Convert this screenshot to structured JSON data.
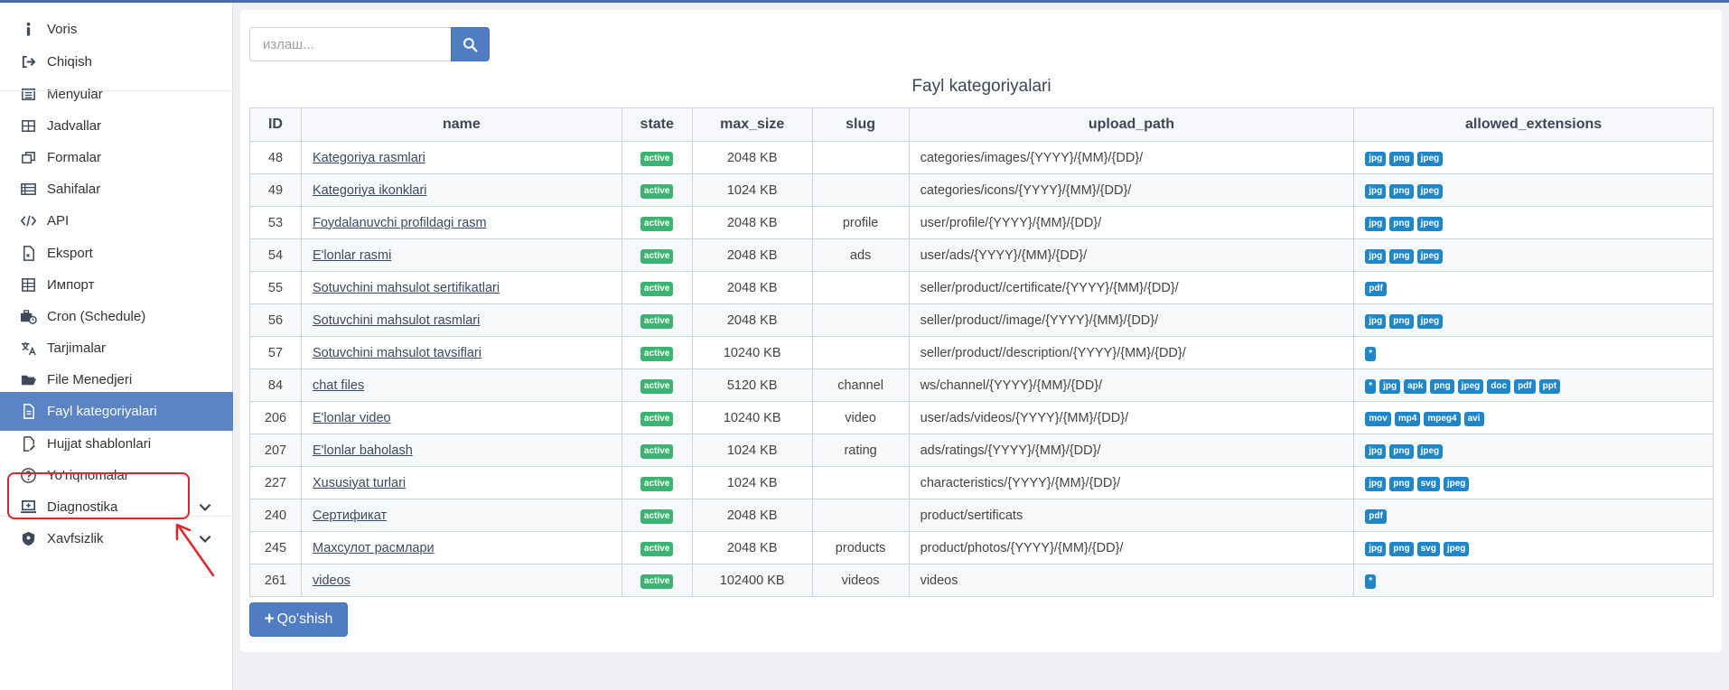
{
  "sidebar": {
    "items": [
      {
        "label": "Voris",
        "icon": "info-icon"
      },
      {
        "label": "Chiqish",
        "icon": "sign-out-icon"
      },
      {
        "label": "Menyular",
        "icon": "list-icon"
      },
      {
        "label": "Jadvallar",
        "icon": "table-icon"
      },
      {
        "label": "Formalar",
        "icon": "window-restore-icon"
      },
      {
        "label": "Sahifalar",
        "icon": "rows-icon"
      },
      {
        "label": "API",
        "icon": "code-icon"
      },
      {
        "label": "Eksport",
        "icon": "file-export-icon"
      },
      {
        "label": "Импорт",
        "icon": "file-excel-icon"
      },
      {
        "label": "Cron (Schedule)",
        "icon": "business-time-icon"
      },
      {
        "label": "Tarjimalar",
        "icon": "language-icon"
      },
      {
        "label": "File Menedjeri",
        "icon": "folder-open-icon"
      },
      {
        "label": "Fayl kategoriyalari",
        "icon": "file-icon",
        "active": true
      },
      {
        "label": "Hujjat shablonlari",
        "icon": "file-signature-icon"
      },
      {
        "label": "Yo'riqnomalar",
        "icon": "question-circle-icon"
      },
      {
        "label": "Diagnostika",
        "icon": "laptop-medical-icon",
        "expandable": true
      },
      {
        "label": "Xavfsizlik",
        "icon": "shield-icon",
        "expandable": true
      }
    ]
  },
  "search": {
    "placeholder": "излаш..."
  },
  "page": {
    "title": "Fayl kategoriyalari"
  },
  "table": {
    "columns": [
      "ID",
      "name",
      "state",
      "max_size",
      "slug",
      "upload_path",
      "allowed_extensions"
    ],
    "rows": [
      {
        "id": "48",
        "name": "Kategoriya rasmlari",
        "state": "active",
        "max_size": "2048 KB",
        "slug": "",
        "upload_path": "categories/images/{YYYY}/{MM}/{DD}/",
        "ext": [
          "jpg",
          "png",
          "jpeg"
        ]
      },
      {
        "id": "49",
        "name": "Kategoriya ikonklari",
        "state": "active",
        "max_size": "1024 KB",
        "slug": "",
        "upload_path": "categories/icons/{YYYY}/{MM}/{DD}/",
        "ext": [
          "jpg",
          "png",
          "jpeg"
        ]
      },
      {
        "id": "53",
        "name": "Foydalanuvchi profildagi rasm",
        "state": "active",
        "max_size": "2048 KB",
        "slug": "profile",
        "upload_path": "user/profile/{YYYY}/{MM}/{DD}/",
        "ext": [
          "jpg",
          "png",
          "jpeg"
        ]
      },
      {
        "id": "54",
        "name": "E'lonlar rasmi",
        "state": "active",
        "max_size": "2048 KB",
        "slug": "ads",
        "upload_path": "user/ads/{YYYY}/{MM}/{DD}/",
        "ext": [
          "jpg",
          "png",
          "jpeg"
        ]
      },
      {
        "id": "55",
        "name": "Sotuvchini mahsulot sertifikatlari",
        "state": "active",
        "max_size": "2048 KB",
        "slug": "",
        "upload_path": "seller/product//certificate/{YYYY}/{MM}/{DD}/",
        "ext": [
          "pdf"
        ]
      },
      {
        "id": "56",
        "name": "Sotuvchini mahsulot rasmlari",
        "state": "active",
        "max_size": "2048 KB",
        "slug": "",
        "upload_path": "seller/product//image/{YYYY}/{MM}/{DD}/",
        "ext": [
          "jpg",
          "png",
          "jpeg"
        ]
      },
      {
        "id": "57",
        "name": "Sotuvchini mahsulot tavsiflari",
        "state": "active",
        "max_size": "10240 KB",
        "slug": "",
        "upload_path": "seller/product//description/{YYYY}/{MM}/{DD}/",
        "ext": [
          "*"
        ]
      },
      {
        "id": "84",
        "name": "chat files",
        "state": "active",
        "max_size": "5120 KB",
        "slug": "channel",
        "upload_path": "ws/channel/{YYYY}/{MM}/{DD}/",
        "ext": [
          "*",
          "jpg",
          "apk",
          "png",
          "jpeg",
          "doc",
          "pdf",
          "ppt"
        ]
      },
      {
        "id": "206",
        "name": "E'lonlar video",
        "state": "active",
        "max_size": "10240 KB",
        "slug": "video",
        "upload_path": "user/ads/videos/{YYYY}/{MM}/{DD}/",
        "ext": [
          "mov",
          "mp4",
          "mpeg4",
          "avi"
        ]
      },
      {
        "id": "207",
        "name": "E'lonlar baholash",
        "state": "active",
        "max_size": "1024 KB",
        "slug": "rating",
        "upload_path": "ads/ratings/{YYYY}/{MM}/{DD}/",
        "ext": [
          "jpg",
          "png",
          "jpeg"
        ]
      },
      {
        "id": "227",
        "name": "Xususiyat turlari",
        "state": "active",
        "max_size": "1024 KB",
        "slug": "",
        "upload_path": "characteristics/{YYYY}/{MM}/{DD}/",
        "ext": [
          "jpg",
          "png",
          "svg",
          "jpeg"
        ]
      },
      {
        "id": "240",
        "name": "Сертификат",
        "state": "active",
        "max_size": "2048 KB",
        "slug": "",
        "upload_path": "product/sertificats",
        "ext": [
          "pdf"
        ]
      },
      {
        "id": "245",
        "name": "Махсулот расмлари",
        "state": "active",
        "max_size": "2048 KB",
        "slug": "products",
        "upload_path": "product/photos/{YYYY}/{MM}/{DD}/",
        "ext": [
          "jpg",
          "png",
          "svg",
          "jpeg"
        ]
      },
      {
        "id": "261",
        "name": "videos",
        "state": "active",
        "max_size": "102400 KB",
        "slug": "videos",
        "upload_path": "videos",
        "ext": [
          "*"
        ]
      }
    ]
  },
  "actions": {
    "add_label": "Qo'shish"
  },
  "colors": {
    "accent": "#4f7cc2",
    "active_badge": "#3cb371",
    "ext_badge": "#1f86c8",
    "highlight": "#e0242b"
  }
}
